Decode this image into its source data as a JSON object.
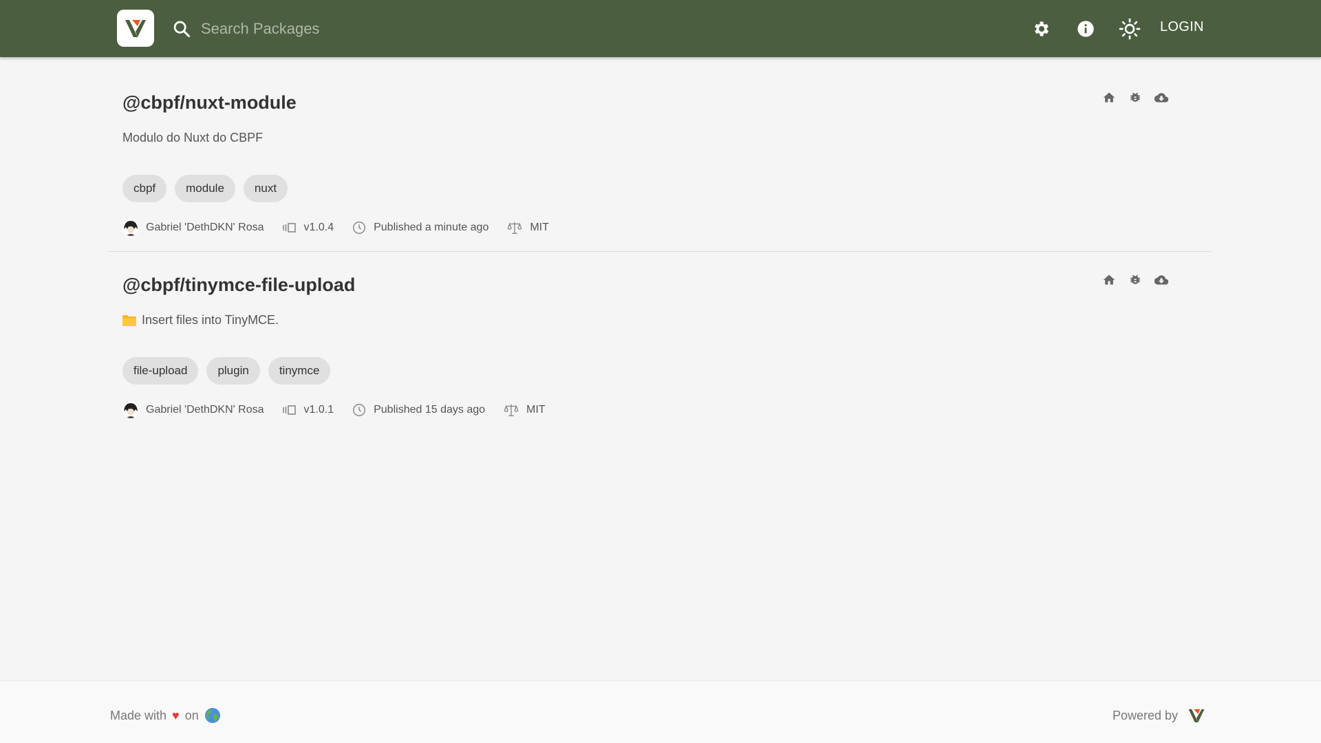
{
  "header": {
    "search_placeholder": "Search Packages",
    "login_label": "LOGIN",
    "bg_color": "#4b5e3f"
  },
  "packages": [
    {
      "name": "@cbpf/nuxt-module",
      "description": "Modulo do Nuxt do CBPF",
      "tags": [
        "cbpf",
        "module",
        "nuxt"
      ],
      "author": "Gabriel 'DethDKN' Rosa",
      "version": "v1.0.4",
      "published": "Published a minute ago",
      "license": "MIT"
    },
    {
      "name": "@cbpf/tinymce-file-upload",
      "description": "Insert files into TinyMCE.",
      "tags": [
        "file-upload",
        "plugin",
        "tinymce"
      ],
      "author": "Gabriel 'DethDKN' Rosa",
      "version": "v1.0.1",
      "published": "Published 15 days ago",
      "license": "MIT"
    }
  ],
  "footer": {
    "made_with": "Made with",
    "heart": "♥",
    "on": "on",
    "powered_by": "Powered by"
  }
}
